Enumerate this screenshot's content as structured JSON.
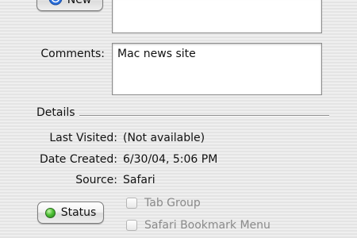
{
  "top_button": {
    "label": "New"
  },
  "comments": {
    "label": "Comments:",
    "value": "Mac news site"
  },
  "details": {
    "heading": "Details",
    "rows": [
      {
        "label": "Last Visited:",
        "value": "(Not available)"
      },
      {
        "label": "Date Created:",
        "value": "6/30/04, 5:06 PM"
      },
      {
        "label": "Source:",
        "value": "Safari"
      }
    ]
  },
  "status_button": {
    "label": "Status",
    "indicator_color": "#3fae2a"
  },
  "checkboxes": [
    {
      "label": "Tab Group",
      "checked": false,
      "enabled": false
    },
    {
      "label": "Safari Bookmark Menu",
      "checked": false,
      "enabled": false
    }
  ],
  "colors": {
    "accent_blue": "#2a6fdc"
  }
}
